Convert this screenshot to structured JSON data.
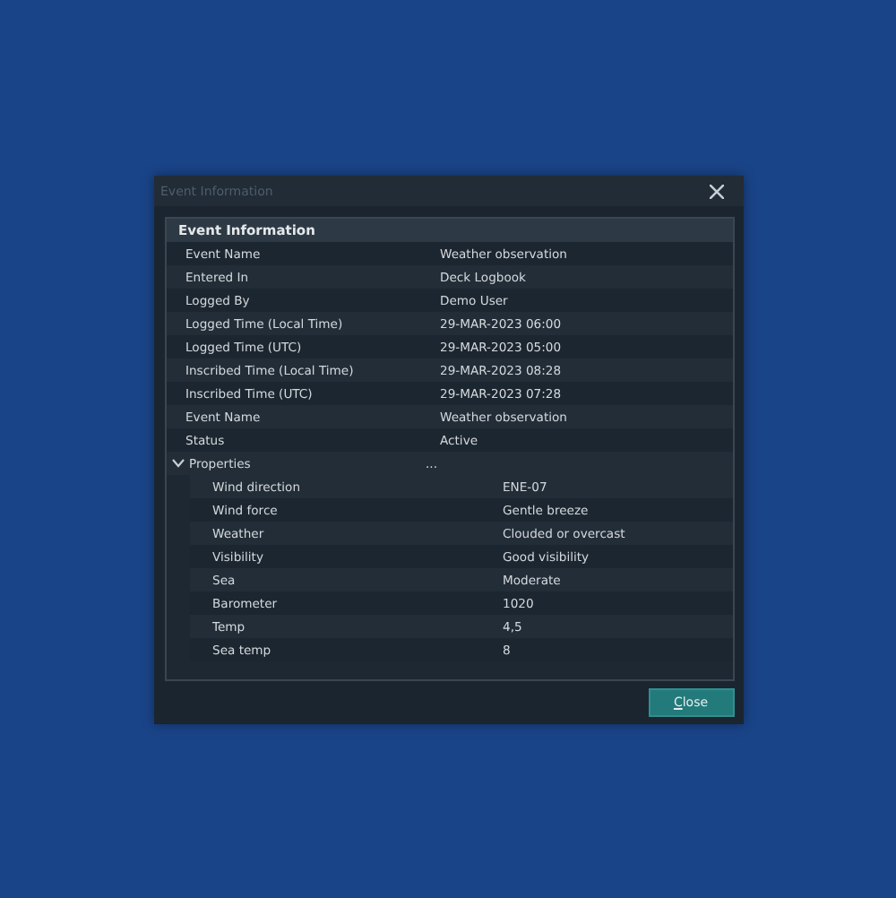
{
  "window": {
    "title": "Event Information"
  },
  "panel": {
    "title": "Event Information",
    "rows": [
      {
        "label": "Event Name",
        "value": "Weather observation"
      },
      {
        "label": "Entered In",
        "value": "Deck Logbook"
      },
      {
        "label": "Logged By",
        "value": "Demo User"
      },
      {
        "label": "Logged Time (Local Time)",
        "value": "29-MAR-2023 06:00"
      },
      {
        "label": "Logged Time (UTC)",
        "value": "29-MAR-2023 05:00"
      },
      {
        "label": "Inscribed Time (Local Time)",
        "value": "29-MAR-2023 08:28"
      },
      {
        "label": "Inscribed Time (UTC)",
        "value": "29-MAR-2023 07:28"
      },
      {
        "label": "Event Name",
        "value": "Weather observation"
      },
      {
        "label": "Status",
        "value": "Active"
      },
      {
        "label": "Properties",
        "value": "...",
        "expanded": true,
        "children": [
          {
            "label": "Wind direction",
            "value": "ENE-07"
          },
          {
            "label": "Wind force",
            "value": "Gentle breeze"
          },
          {
            "label": "Weather",
            "value": "Clouded or overcast"
          },
          {
            "label": "Visibility",
            "value": "Good visibility"
          },
          {
            "label": "Sea",
            "value": "Moderate"
          },
          {
            "label": "Barometer",
            "value": "1020"
          },
          {
            "label": "Temp",
            "value": "4,5"
          },
          {
            "label": "Sea temp",
            "value": "8"
          }
        ]
      }
    ]
  },
  "buttons": [
    {
      "label": "Close"
    }
  ]
}
